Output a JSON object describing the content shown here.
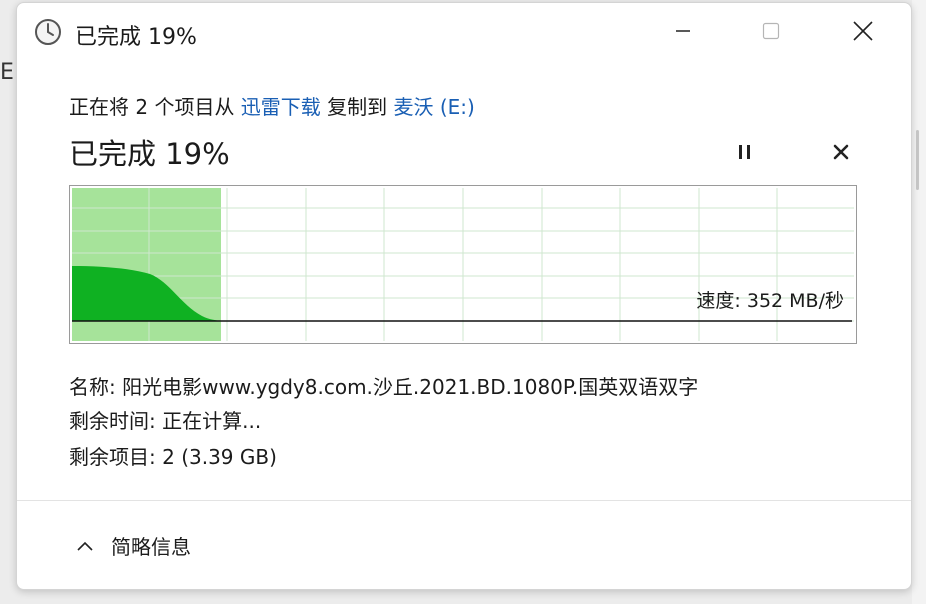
{
  "window": {
    "title": "已完成 19%",
    "icons": {
      "app": "clock-icon",
      "minimize": "minimize-icon",
      "maximize": "maximize-icon",
      "close": "close-icon"
    }
  },
  "copy": {
    "prefix": "正在将 2 个项目从 ",
    "source": "迅雷下载",
    "middle": " 复制到 ",
    "dest": "麦沃 (E:)"
  },
  "progress": {
    "label": "已完成 19%",
    "percent": 19
  },
  "controls": {
    "pause": "pause-icon",
    "cancel": "cancel-icon"
  },
  "graph": {
    "speed_text": "速度: 352 MB/秒",
    "colors": {
      "completed_area": "#a6e39a",
      "speed_area": "#0fb122",
      "grid": "#cfe7cf",
      "speed_line": "#111111"
    }
  },
  "details": {
    "name_label": "名称:",
    "name_value": "阳光电影www.ygdy8.com.沙丘.2021.BD.1080P.国英双语双字",
    "time_label": "剩余时间:",
    "time_value": "正在计算...",
    "items_label": "剩余项目:",
    "items_value": "2 (3.39 GB)"
  },
  "footer": {
    "toggle_label": "简略信息",
    "toggle_icon": "chevron-up-icon"
  }
}
